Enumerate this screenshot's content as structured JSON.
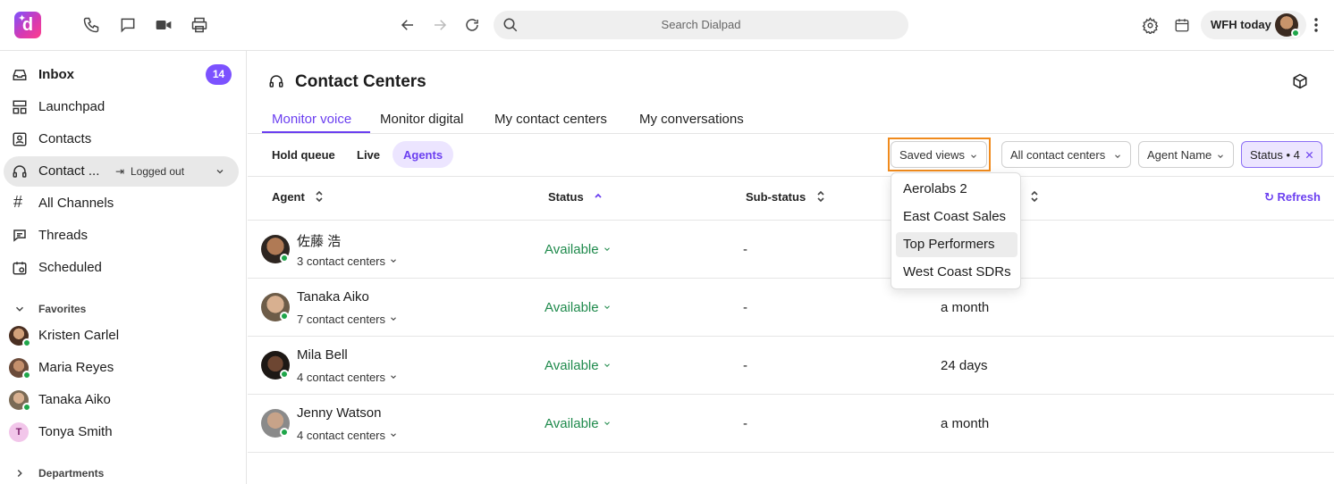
{
  "topbar": {
    "search_placeholder": "Search Dialpad",
    "status_label": "WFH today"
  },
  "sidebar": {
    "items": [
      {
        "label": "Inbox",
        "badge": "14"
      },
      {
        "label": "Launchpad"
      },
      {
        "label": "Contacts"
      },
      {
        "label": "Contact ...",
        "status": "Logged out"
      },
      {
        "label": "All Channels"
      },
      {
        "label": "Threads"
      },
      {
        "label": "Scheduled"
      }
    ],
    "favorites_title": "Favorites",
    "favorites": [
      {
        "name": "Kristen Carlel"
      },
      {
        "name": "Maria Reyes"
      },
      {
        "name": "Tanaka Aiko"
      },
      {
        "name": "Tonya Smith",
        "initial": "T"
      }
    ],
    "departments_title": "Departments"
  },
  "main": {
    "title": "Contact Centers",
    "tabs": [
      {
        "label": "Monitor voice"
      },
      {
        "label": "Monitor digital"
      },
      {
        "label": "My contact centers"
      },
      {
        "label": "My conversations"
      }
    ],
    "subtabs": [
      {
        "label": "Hold queue"
      },
      {
        "label": "Live"
      },
      {
        "label": "Agents"
      }
    ],
    "filters": {
      "saved_views": "Saved views",
      "contact_centers": "All contact centers",
      "agent_name": "Agent Name",
      "status": "Status • 4"
    },
    "columns": {
      "agent": "Agent",
      "status": "Status",
      "substatus": "Sub-status"
    },
    "refresh_label": "Refresh",
    "rows": [
      {
        "name": "佐藤 浩",
        "centers": "3 contact centers",
        "status": "Available",
        "substatus": "-",
        "duration": ""
      },
      {
        "name": "Tanaka Aiko",
        "centers": "7 contact centers",
        "status": "Available",
        "substatus": "-",
        "duration": "a month"
      },
      {
        "name": "Mila Bell",
        "centers": "4 contact centers",
        "status": "Available",
        "substatus": "-",
        "duration": "24 days"
      },
      {
        "name": "Jenny Watson",
        "centers": "4 contact centers",
        "status": "Available",
        "substatus": "-",
        "duration": "a month"
      }
    ]
  },
  "saved_views_menu": {
    "items": [
      "Aerolabs 2",
      "East Coast Sales",
      "Top Performers",
      "West Coast SDRs"
    ],
    "highlighted": "Top Performers"
  },
  "colors": {
    "accent": "#6b3ff0",
    "available": "#1f8a4c",
    "highlight_frame": "#f08a1c"
  }
}
